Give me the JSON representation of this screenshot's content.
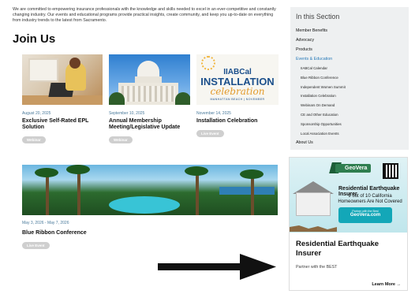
{
  "intro_text": "We are committed to empowering insurance professionals with the knowledge and skills needed to excel in an ever-competitive and constantly changing industry. Our events and educational programs provide practical insights, create community, and keep you up-to-date on everything from industry trends to the latest from Sacramento.",
  "section_title": "Join Us",
  "events": [
    {
      "date": "August 20, 2025",
      "title": "Exclusive Self-Rated EPL Solution",
      "badge": "Webinar"
    },
    {
      "date": "September 10, 2025",
      "title": "Annual Membership Meeting/Legislative Update",
      "badge": "Webinar"
    },
    {
      "date": "November 14, 2025",
      "title": "Installation Celebration",
      "badge": "Live Event",
      "thumb": {
        "line1": "IIABCal",
        "line2": "INSTALLATION",
        "line3": "celebration",
        "line4": "MANHATTAN BEACH | NOVEMBER"
      }
    },
    {
      "date": "May 3, 2026 - May 7, 2026",
      "title": "Blue Ribbon Conference",
      "badge": "Live Event"
    }
  ],
  "sidebar": {
    "title": "In this Section",
    "items": [
      {
        "label": "Member Benefits"
      },
      {
        "label": "Advocacy"
      },
      {
        "label": "Products"
      },
      {
        "label": "Events & Education",
        "active": true
      }
    ],
    "subitems": [
      "IIABCal Calendar",
      "Blue Ribbon Conference",
      "Independent Women Summit",
      "Installation Celebration",
      "Webinars On Demand",
      "CE and Other Education",
      "Sponsorship Opportunities",
      "Local Association Events"
    ],
    "last_item": "About Us"
  },
  "ad": {
    "brand": "GeoVera",
    "headline": "Residential Earthquake Insurer",
    "subheadline": "9 out of 10 California Homeowners Are Not Covered",
    "partner_line": "Partner with the Best",
    "partner_url": "GeoVera.com",
    "title": "Residential Earthquake Insurer",
    "subtitle": "Partner with the BEST",
    "cta": "Learn More →"
  },
  "colors": {
    "accent": "#2a7bb9",
    "badge": "#cfcfcf",
    "sidebar_bg": "#eef0f1",
    "ad_teal": "#13a7b8"
  }
}
